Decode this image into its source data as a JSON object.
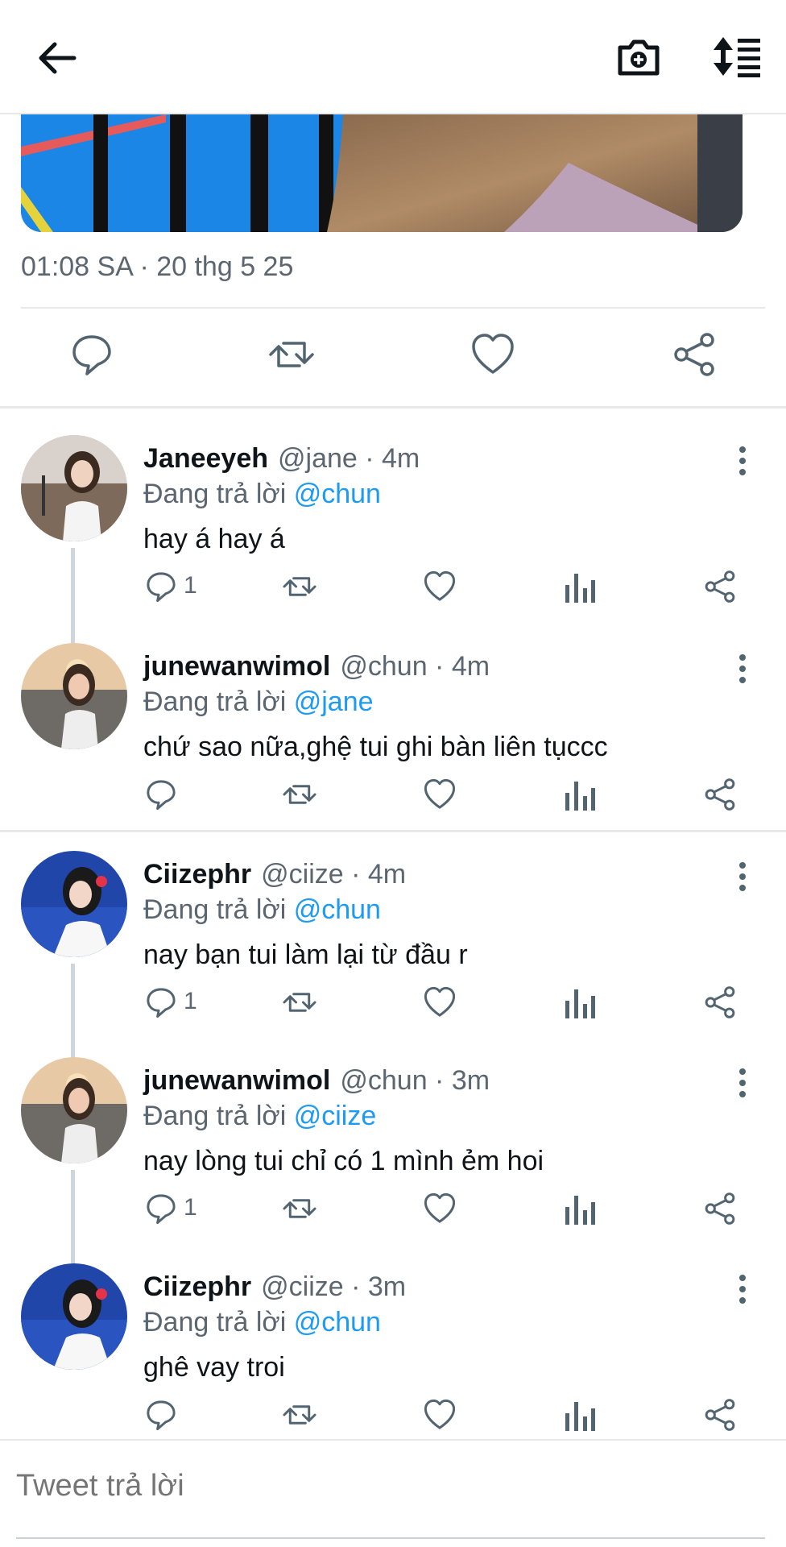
{
  "header": {
    "back_icon": "arrow-left-icon",
    "camera_icon": "camera-plus-icon",
    "sort_icon": "sort-replies-icon"
  },
  "tweet": {
    "timestamp": "01:08 SA · 20 thg 5 25",
    "actions": [
      "reply-icon",
      "retweet-icon",
      "like-icon",
      "share-icon"
    ]
  },
  "replies": [
    {
      "name": "Janeeyeh",
      "meta": "@jane · 4m",
      "replying_prefix": "Đang trả lời",
      "mention": "@chun",
      "text": "hay á hay á",
      "reply_count": "1"
    },
    {
      "name": "junewanwimol",
      "meta": "@chun · 4m",
      "replying_prefix": "Đang trả lời",
      "mention": "@jane",
      "text": "chứ sao nữa,ghệ tui ghi bàn liên tụccc",
      "reply_count": ""
    },
    {
      "name": "Ciizephr",
      "meta": "@ciize · 4m",
      "replying_prefix": "Đang trả lời",
      "mention": "@chun",
      "text": "nay bạn tui làm lại từ đầu r",
      "reply_count": "1"
    },
    {
      "name": "junewanwimol",
      "meta": "@chun · 3m",
      "replying_prefix": "Đang trả lời",
      "mention": "@ciize",
      "text": "nay lòng tui chỉ có 1 mình ẻm hoi",
      "reply_count": "1"
    },
    {
      "name": "Ciizephr",
      "meta": "@ciize · 3m",
      "replying_prefix": "Đang trả lời",
      "mention": "@chun",
      "text": "ghê vay troi",
      "reply_count": ""
    }
  ],
  "composer": {
    "placeholder": "Tweet trả lời"
  },
  "colors": {
    "accent": "#1d9bf0",
    "muted": "#5b6670",
    "icon": "#536471"
  }
}
